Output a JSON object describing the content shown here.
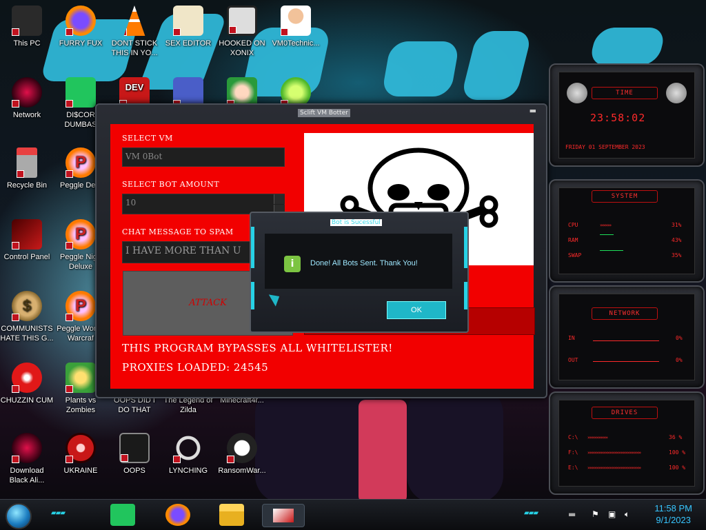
{
  "desktop_icons": [
    {
      "label": "This PC",
      "icon": "monitor-icon"
    },
    {
      "label": "FURRY FUX",
      "icon": "firefox-icon"
    },
    {
      "label": "DONT STICK THIS IN YO...",
      "icon": "vlc-cone-icon"
    },
    {
      "label": "SEX EDITOR",
      "icon": "hex-editor-icon"
    },
    {
      "label": "HOOKED ON XONIX",
      "icon": "xonix-game-icon"
    },
    {
      "label": "VM0Technic...",
      "icon": "doctor-icon"
    },
    {
      "label": "Network",
      "icon": "alien-network-icon"
    },
    {
      "label": "DI$COR DUMBAS",
      "icon": "chat-icon"
    },
    {
      "label": "",
      "icon": "dev-cpp-icon"
    },
    {
      "label": "",
      "icon": "card-icon"
    },
    {
      "label": "",
      "icon": "santa-icon"
    },
    {
      "label": "",
      "icon": "lime-icon"
    },
    {
      "label": "Recycle Bin",
      "icon": "recycle-bin-icon"
    },
    {
      "label": "Peggle Delu",
      "icon": "peggle-icon"
    },
    {
      "label": "Control Panel",
      "icon": "control-panel-icon"
    },
    {
      "label": "Peggle Nigh Deluxe",
      "icon": "peggle-icon"
    },
    {
      "label": "COMMUNISTS HATE THIS G...",
      "icon": "money-bag-icon"
    },
    {
      "label": "Peggle Wor of Warcraf",
      "icon": "peggle-icon"
    },
    {
      "label": "CHUZZIN CUM",
      "icon": "chuzzle-icon"
    },
    {
      "label": "Plants vs Zombies",
      "icon": "plant-icon"
    },
    {
      "label": "OOPS DID I DO THAT",
      "icon": "blank-icon"
    },
    {
      "label": "The Legend of Zilda",
      "icon": "blank-icon"
    },
    {
      "label": "Minecraft4r...",
      "icon": "blank-icon"
    },
    {
      "label": "Download Black Ali...",
      "icon": "alien-network-icon"
    },
    {
      "label": "UKRAINE",
      "icon": "radiation-icon"
    },
    {
      "label": "OOPS",
      "icon": "oops-icon"
    },
    {
      "label": "LYNCHING",
      "icon": "noose-icon"
    },
    {
      "label": "RansomWar...",
      "icon": "skull-icon"
    }
  ],
  "app_window": {
    "title": "Sclift VM Botter",
    "select_vm_label": "SELECT VM",
    "select_vm_value": "VM 0Bot",
    "bot_amount_label": "SELECT BOT AMOUNT",
    "bot_amount_value": "10",
    "chat_label": "CHAT MESSAGE TO SPAM",
    "chat_value": "I HAVE MORE THAN U",
    "attack_label": "ATTACK",
    "bypass_text": "THIS PROGRAM BYPASSES ALL WHITELISTER!",
    "proxies_text": "PROXIES LOADED: 24545"
  },
  "dialog": {
    "title": "Bot is Sucessful",
    "message": "Done! All Bots Sent. Thank You!",
    "ok_label": "OK"
  },
  "gadgets": {
    "time": {
      "head": "TIME",
      "clock": "23:58:02",
      "date": "FRIDAY 01 SEPTEMBER 2023"
    },
    "system": {
      "head": "SYSTEM",
      "rows": [
        {
          "label": "CPU",
          "value": "31%"
        },
        {
          "label": "RAM",
          "value": "43%"
        },
        {
          "label": "SWAP",
          "value": "35%"
        }
      ]
    },
    "network": {
      "head": "NETWORK",
      "rows": [
        {
          "label": "IN",
          "value": "0%"
        },
        {
          "label": "OUT",
          "value": "0%"
        }
      ]
    },
    "drives": {
      "head": "DRIVES",
      "rows": [
        {
          "label": "C:\\",
          "value": "36 %"
        },
        {
          "label": "F:\\",
          "value": "100 %"
        },
        {
          "label": "E:\\",
          "value": "100 %"
        }
      ]
    }
  },
  "taskbar": {
    "apps": [
      "chat-icon",
      "firefox-icon",
      "file-explorer-icon",
      "monitor-icon"
    ],
    "time": "11:58 PM",
    "date": "9/1/2023"
  },
  "colors": {
    "accent_red": "#f20000",
    "cyan": "#27d2e6",
    "gadget_red": "#ff2a2a",
    "clock_blue": "#37c6ff"
  }
}
